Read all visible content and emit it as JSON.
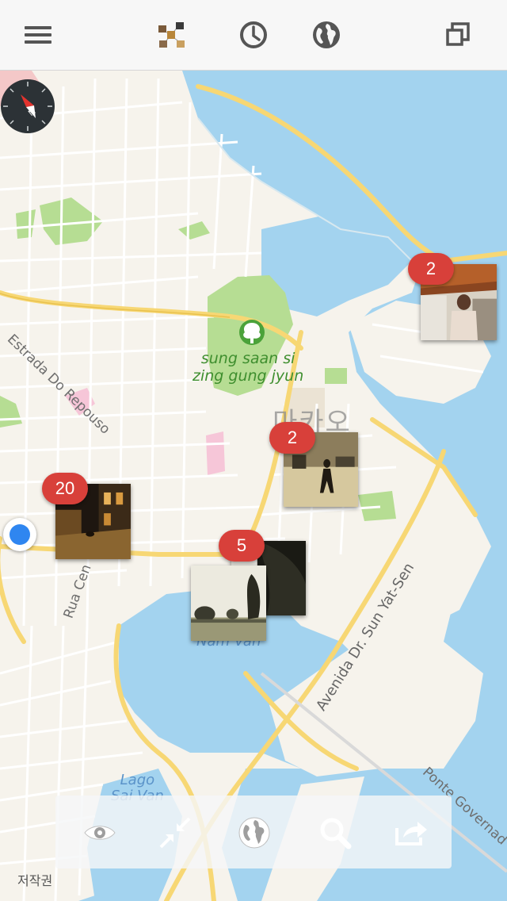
{
  "top_bar": {
    "menu_icon": "hamburger-icon",
    "thumbnail_icon": "photo-collage-thumbnail",
    "history_icon": "clock-icon",
    "globe_icon": "globe-icon",
    "window_icon": "overlap-squares-icon"
  },
  "map": {
    "labels": {
      "park": "sung saan si\nzing gung jyun",
      "city": "마카오",
      "estrada": "Estrada Do Repouso",
      "rua": "Rua Cen",
      "avenida": "Avenida Dr. Sun Yat-Sen",
      "ponte": "Ponte Governad",
      "nam_van": "Nam Van",
      "lago": "Lago\nSai Van"
    },
    "clusters": [
      {
        "count": "2",
        "photo": "arcade-walkway"
      },
      {
        "count": "2",
        "photo": "street-walker"
      },
      {
        "count": "20",
        "photo": "night-street"
      },
      {
        "count": "5",
        "photo": "trees-silhouette"
      }
    ],
    "compass_icon": "compass-icon",
    "user_location": "current-location-dot",
    "copyright": "저작권"
  },
  "toolbar": {
    "icons": [
      "eye-icon",
      "collapse-arrows-icon",
      "globe-icon",
      "search-icon",
      "share-icon"
    ]
  },
  "colors": {
    "water": "#a3d3ef",
    "land": "#f6f3ec",
    "park": "#b6dd93",
    "badge": "#d8403a",
    "road_major": "#f7d774"
  }
}
